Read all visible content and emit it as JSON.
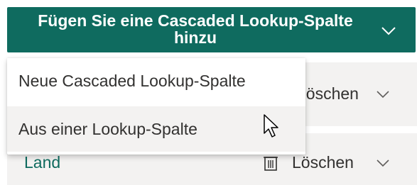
{
  "header": {
    "add_button_label": "Fügen Sie eine Cascaded Lookup-Spalte hinzu",
    "accent_color": "#0f6b5f"
  },
  "menu": {
    "items": [
      {
        "label": "Neue Cascaded Lookup-Spalte"
      },
      {
        "label": "Aus einer Lookup-Spalte"
      }
    ]
  },
  "rows": [
    {
      "delete_label": "Löschen"
    },
    {
      "name": "Land",
      "delete_label": "Löschen"
    }
  ],
  "icons": {
    "chevron": "chevron-down-icon",
    "trash": "trash-icon",
    "cursor": "mouse-pointer-icon"
  }
}
